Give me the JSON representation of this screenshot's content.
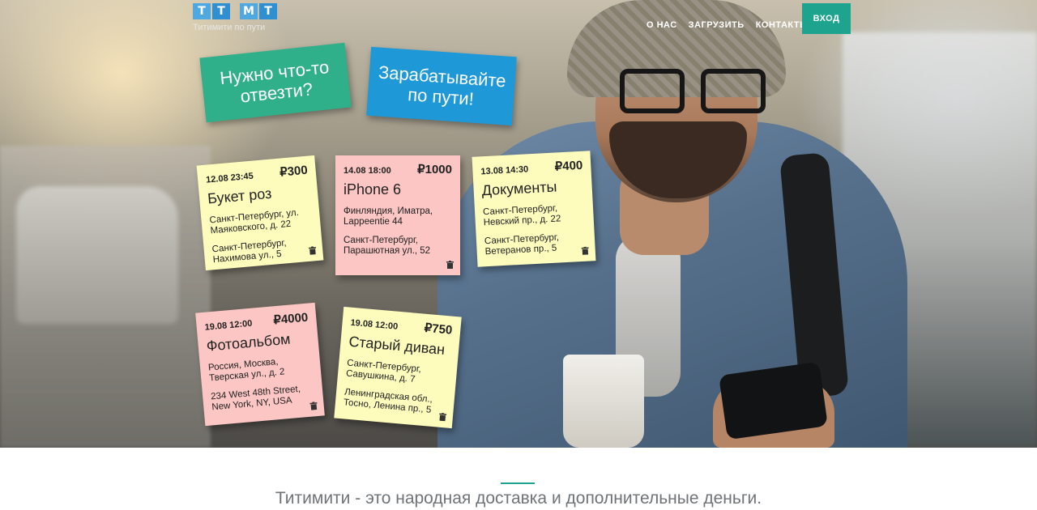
{
  "header": {
    "logo_letters": [
      "Т",
      "Т",
      "М",
      "Т"
    ],
    "tagline": "Титимити по пути",
    "nav": [
      "О НАС",
      "ЗАГРУЗИТЬ",
      "КОНТАКТЫ"
    ],
    "login_label": "ВХОД",
    "accent_color": "#1ea38f"
  },
  "cta": {
    "send": "Нужно что-то отвезти?",
    "earn": "Зарабатывайте по пути!"
  },
  "notes": [
    {
      "date": "12.08 23:45",
      "price": "₽300",
      "title": "Букет роз",
      "from": "Санкт-Петербург, ул. Маяковского, д. 22",
      "to": "Санкт-Петербург, Нахимова ул., 5",
      "color": "yellow"
    },
    {
      "date": "14.08 18:00",
      "price": "₽1000",
      "title": "iPhone 6",
      "from": "Финляндия, Иматра, Lappeentie 44",
      "to": "Санкт-Петербург, Парашютная ул., 52",
      "color": "pink"
    },
    {
      "date": "13.08 14:30",
      "price": "₽400",
      "title": "Документы",
      "from": "Санкт-Петербург, Невский пр., д. 22",
      "to": "Санкт-Петербург, Ветеранов пр., 5",
      "color": "yellow"
    },
    {
      "date": "19.08 12:00",
      "price": "₽4000",
      "title": "Фотоальбом",
      "from": "Россия, Москва, Тверская ул., д. 2",
      "to": "234 West 48th Street, New York, NY, USA",
      "color": "pink"
    },
    {
      "date": "19.08 12:00",
      "price": "₽750",
      "title": "Старый диван",
      "from": "Санкт-Петербург, Савушкина, д. 7",
      "to": "Ленинградская обл., Тосно, Ленина пр., 5",
      "color": "yellow"
    }
  ],
  "footer": {
    "headline": "Титимити - это народная доставка и дополнительные деньги."
  },
  "icons": [
    "trash-icon"
  ]
}
